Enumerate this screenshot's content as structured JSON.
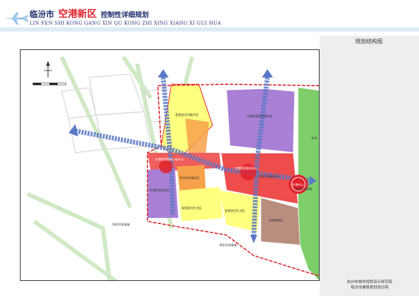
{
  "header": {
    "city": "临汾市",
    "zone": "空港新区",
    "plan": "控制性详细规划",
    "subtitle": "LIN FEN SHI KONG GANG XIN QU KONG ZHI XING XIANG XI GUI HUA"
  },
  "panel": {
    "label": "规划结构图"
  },
  "credits": {
    "line1": "杭州市城市规划设计研究院",
    "line2": "临汾市建筑规划设计院"
  },
  "map": {
    "labels": {
      "west_center": "空港配套服务二级中心",
      "core_center": "空港配套服务核心",
      "airport_center": "空港中心",
      "north_green": "空港配套综合服务区",
      "west_purple": "空港物流配送区",
      "south_yellow": "配套居住生活区",
      "south_yellow2": "配套居住生活区",
      "middle_orange": "综合商务服务区",
      "brown_zone": "仓储物流区",
      "airport_green": "机场",
      "west_yellow": "配套居住功能片区",
      "east_center": "空港产业服务中心",
      "south_axis_1": "南北向发展轴",
      "south_axis_2": "南北向发展轴",
      "east_axis": "东西向发展轴"
    },
    "colors": {
      "yellow": "#ffff80",
      "orange": "#f7a24a",
      "red": "#ef4c4c",
      "purple": "#a980d6",
      "green": "#7ecf6a",
      "brown": "#b98e7e",
      "boundary": "#e0212b",
      "axis": "#5a78c8"
    }
  }
}
